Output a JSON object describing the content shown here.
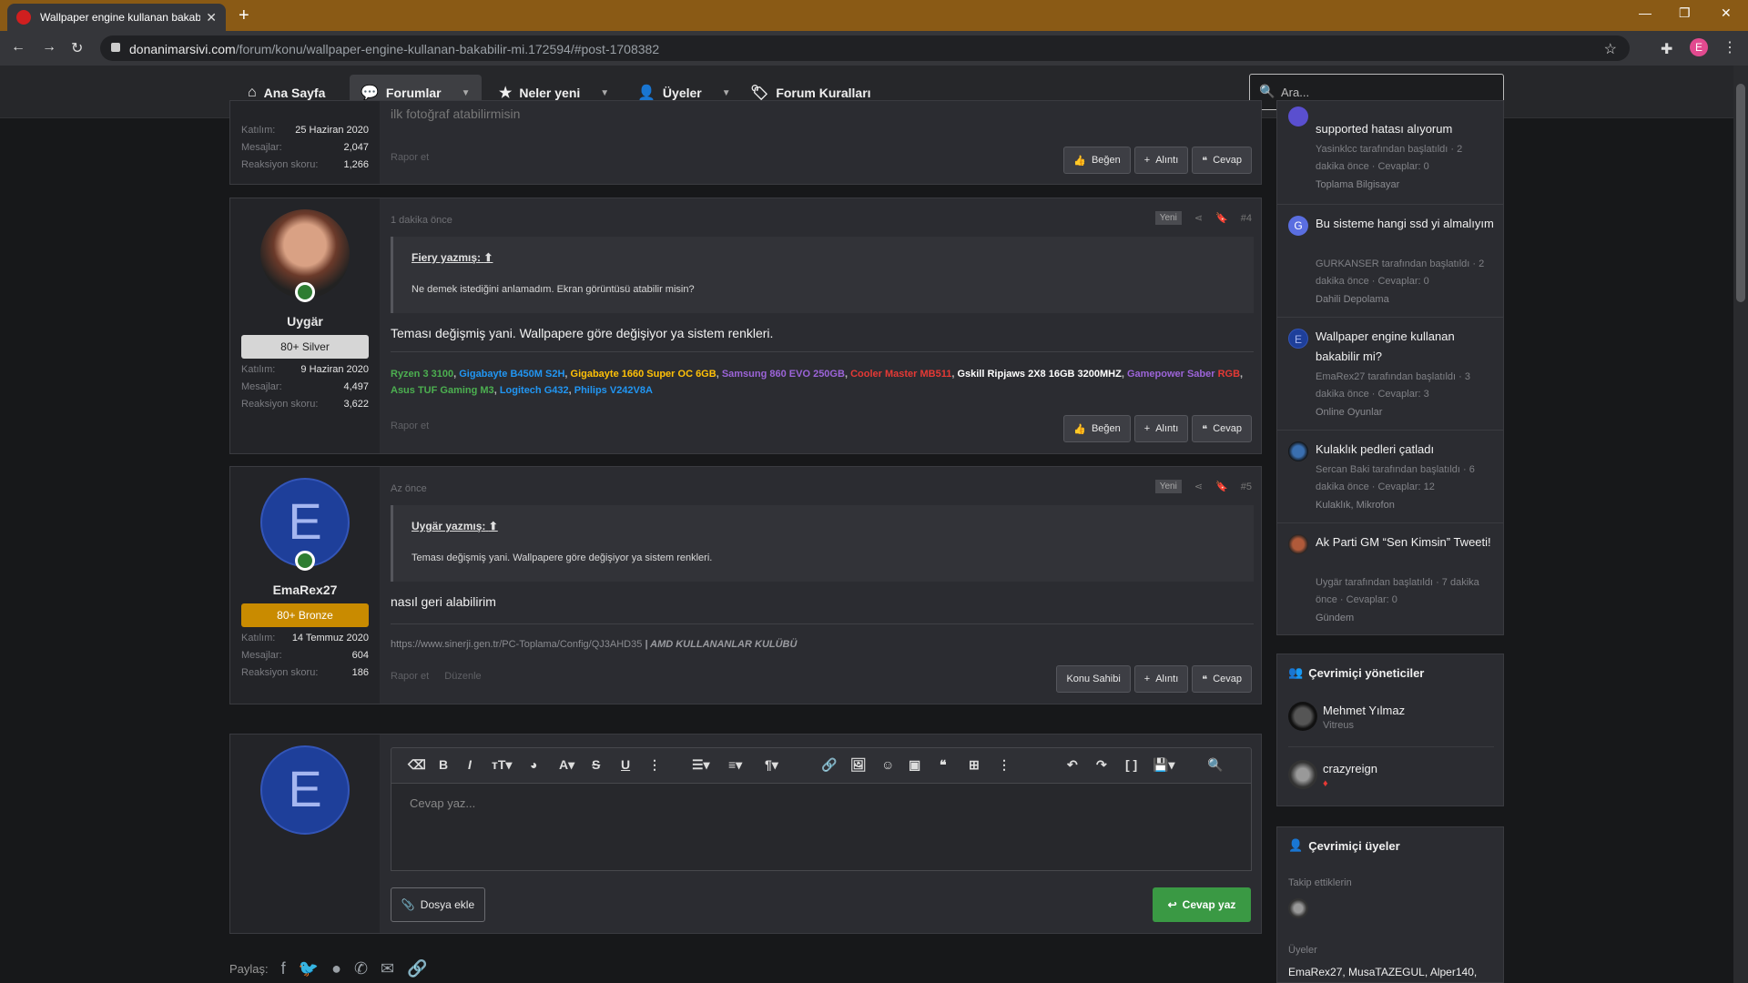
{
  "browser": {
    "tab_title": "Wallpaper engine kullanan bakab",
    "url_host": "donanimarsivi.com",
    "url_path": "/forum/konu/wallpaper-engine-kullanan-bakabilir-mi.172594/#post-1708382",
    "profile_initial": "E"
  },
  "nav": {
    "home": "Ana Sayfa",
    "forums": "Forumlar",
    "whats_new": "Neler yeni",
    "members": "Üyeler",
    "rules": "Forum Kuralları",
    "search_placeholder": "Ara..."
  },
  "posts": {
    "prev": {
      "joined_label": "Katılım:",
      "joined": "25 Haziran 2020",
      "messages_label": "Mesajlar:",
      "messages": "2,047",
      "reaction_label": "Reaksiyon skoru:",
      "reaction": "1,266",
      "partial_text": "ilk fotoğraf atabilirmisin",
      "report": "Rapor et",
      "like": "Beğen",
      "quote": "Alıntı",
      "reply": "Cevap"
    },
    "p4": {
      "username": "Uygär",
      "rank": "80+ Silver",
      "joined_label": "Katılım:",
      "joined": "9 Haziran 2020",
      "messages_label": "Mesajlar:",
      "messages": "4,497",
      "reaction_label": "Reaksiyon skoru:",
      "reaction": "3,622",
      "time": "1 dakika önce",
      "new": "Yeni",
      "num": "#4",
      "quote_author": "Fiery yazmış:",
      "quote_text": "Ne demek istediğini anlamadım. Ekran görüntüsü atabilir misin?",
      "body": "Teması değişmiş yani. Wallpapere göre değişiyor ya sistem renkleri.",
      "signature": [
        {
          "text": "Ryzen 3 3100",
          "color": "#4caf50"
        },
        {
          "text": ", ",
          "color": "#bbbbbb"
        },
        {
          "text": "Gigabayte B450M S2H",
          "color": "#2196f3"
        },
        {
          "text": ", ",
          "color": "#bbbbbb"
        },
        {
          "text": "Gigabayte 1660 Super OC 6GB",
          "color": "#ffc107"
        },
        {
          "text": ", ",
          "color": "#bbbbbb"
        },
        {
          "text": "Samsung 860 EVO 250GB",
          "color": "#9c64d8"
        },
        {
          "text": ", ",
          "color": "#bbbbbb"
        },
        {
          "text": "Cooler Master MB511",
          "color": "#e53935"
        },
        {
          "text": ", ",
          "color": "#bbbbbb"
        },
        {
          "text": "Gskill Ripjaws 2X8 16GB 3200MHZ",
          "color": "#ffffff"
        },
        {
          "text": ", ",
          "color": "#bbbbbb"
        },
        {
          "text": "Gamepower Saber ",
          "color": "#9c64d8"
        },
        {
          "text": "RGB",
          "color": "#e53935"
        },
        {
          "text": ", ",
          "color": "#bbbbbb"
        },
        {
          "text": "Asus TUF Gaming M3",
          "color": "#4caf50"
        },
        {
          "text": ", ",
          "color": "#bbbbbb"
        },
        {
          "text": "Logitech G432",
          "color": "#2196f3"
        },
        {
          "text": ", ",
          "color": "#bbbbbb"
        },
        {
          "text": "Philips V242V8A",
          "color": "#2196f3"
        }
      ],
      "report": "Rapor et",
      "like": "Beğen",
      "quote": "Alıntı",
      "reply": "Cevap"
    },
    "p5": {
      "avatar_letter": "E",
      "username": "EmaRex27",
      "rank": "80+ Bronze",
      "joined_label": "Katılım:",
      "joined": "14 Temmuz 2020",
      "messages_label": "Mesajlar:",
      "messages": "604",
      "reaction_label": "Reaksiyon skoru:",
      "reaction": "186",
      "time": "Az önce",
      "new": "Yeni",
      "num": "#5",
      "quote_author": "Uygär yazmış:",
      "quote_text": "Teması değişmiş yani. Wallpapere göre değişiyor ya sistem renkleri.",
      "body": "nasıl geri alabilirim",
      "sig_link": "https://www.sinerji.gen.tr/PC-Toplama/Config/QJ3AHD35",
      "sig_club": "| AMD KULLANANLAR KULÜBÜ",
      "report": "Rapor et",
      "edit": "Düzenle",
      "owner": "Konu Sahibi",
      "quote": "Alıntı",
      "reply": "Cevap"
    }
  },
  "editor": {
    "avatar_letter": "E",
    "placeholder": "Cevap yaz...",
    "attach": "Dosya ekle",
    "submit": "Cevap yaz"
  },
  "share": {
    "label": "Paylaş:"
  },
  "sidebar": {
    "threads": [
      {
        "title": "supported hatası alıyorum",
        "meta": "Yasinklcc tarafından başlatıldı · 2 dakika önce · Cevaplar: 0",
        "forum": "Toplama Bilgisayar"
      },
      {
        "initial": "G",
        "title": "Bu sisteme hangi ssd yi almalıyım",
        "meta": "GURKANSER tarafından başlatıldı · 2 dakika önce · Cevaplar: 0",
        "forum": "Dahili Depolama"
      },
      {
        "initial": "E",
        "title": "Wallpaper engine kullanan bakabilir mi?",
        "meta": "EmaRex27 tarafından başlatıldı · 3 dakika önce · Cevaplar: 3",
        "forum": "Online Oyunlar"
      },
      {
        "title": "Kulaklık pedleri çatladı",
        "meta": "Sercan Baki tarafından başlatıldı · 6 dakika önce · Cevaplar: 12",
        "forum": "Kulaklık, Mikrofon"
      },
      {
        "title": "Ak Parti GM “Sen Kimsin” Tweeti!",
        "meta": "Uygär tarafından başlatıldı · 7 dakika önce · Cevaplar: 0",
        "forum": "Gündem"
      }
    ],
    "mods_title": "Çevrimiçi yöneticiler",
    "mods": [
      {
        "name": "Mehmet Yılmaz",
        "sub": "Vitreus"
      },
      {
        "name": "crazyreign",
        "sub": ""
      }
    ],
    "members_title": "Çevrimiçi üyeler",
    "following_label": "Takip ettiklerin",
    "members_label": "Üyeler",
    "members_list": "EmaRex27, MusaTAZEGUL, Alper140,"
  }
}
